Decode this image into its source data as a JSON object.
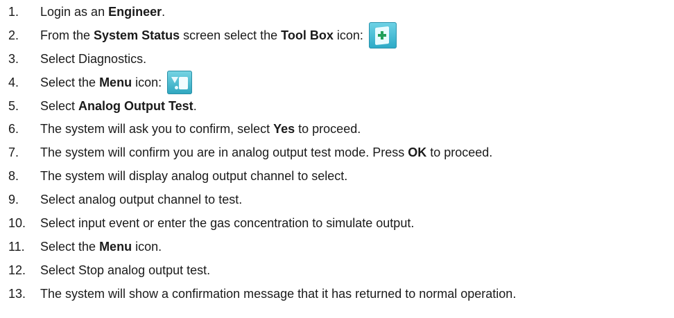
{
  "steps": [
    {
      "num": "1.",
      "parts": [
        {
          "t": "Login as an "
        },
        {
          "t": "Engineer",
          "b": true
        },
        {
          "t": "."
        }
      ]
    },
    {
      "num": "2.",
      "parts": [
        {
          "t": "From the "
        },
        {
          "t": "System Status",
          "b": true
        },
        {
          "t": " screen select the "
        },
        {
          "t": "Tool Box",
          "b": true
        },
        {
          "t": " icon:"
        }
      ],
      "icon": "toolbox-icon"
    },
    {
      "num": "3.",
      "parts": [
        {
          "t": "Select Diagnostics."
        }
      ]
    },
    {
      "num": "4.",
      "parts": [
        {
          "t": "Select the "
        },
        {
          "t": "Menu",
          "b": true
        },
        {
          "t": " icon:"
        }
      ],
      "icon": "menu-icon"
    },
    {
      "num": "5.",
      "parts": [
        {
          "t": "Select "
        },
        {
          "t": "Analog Output Test",
          "b": true
        },
        {
          "t": "."
        }
      ]
    },
    {
      "num": "6.",
      "parts": [
        {
          "t": "The system will ask you to confirm, select "
        },
        {
          "t": "Yes",
          "b": true
        },
        {
          "t": " to proceed."
        }
      ]
    },
    {
      "num": "7.",
      "parts": [
        {
          "t": "The system will confirm you are in analog output test mode. Press "
        },
        {
          "t": "OK",
          "b": true
        },
        {
          "t": " to proceed."
        }
      ]
    },
    {
      "num": "8.",
      "parts": [
        {
          "t": "The system will display analog output channel to select."
        }
      ]
    },
    {
      "num": "9.",
      "parts": [
        {
          "t": "Select analog output channel to test."
        }
      ]
    },
    {
      "num": "10.",
      "parts": [
        {
          "t": "Select input event or enter the gas concentration to simulate output."
        }
      ]
    },
    {
      "num": "11.",
      "parts": [
        {
          "t": "Select the "
        },
        {
          "t": "Menu",
          "b": true
        },
        {
          "t": " icon."
        }
      ]
    },
    {
      "num": "12.",
      "parts": [
        {
          "t": "Select Stop analog output test."
        }
      ]
    },
    {
      "num": "13.",
      "parts": [
        {
          "t": "The system will show a confirmation message that it has returned to normal operation."
        }
      ]
    }
  ],
  "icon_colors": {
    "accent": "#2ba9c6",
    "plus": "#22a05b"
  }
}
